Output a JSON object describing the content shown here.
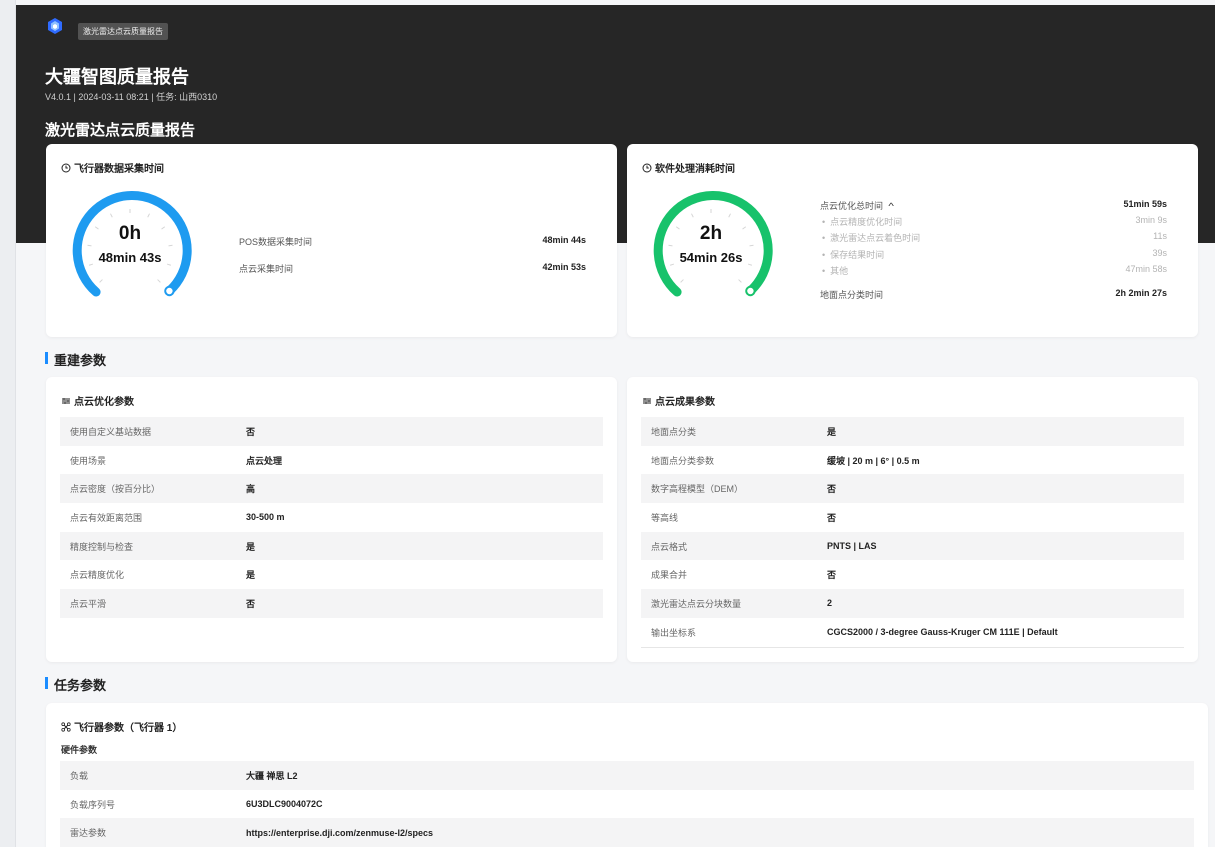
{
  "header": {
    "tag": "激光雷达点云质量报告",
    "app_title": "大疆智图质量报告",
    "meta": "V4.0.1 | 2024-03-11 08:21 | 任务: 山西0310",
    "report_title": "激光雷达点云质量报告"
  },
  "flight_time": {
    "title": "飞行器数据采集时间",
    "gauge_hours": "0h",
    "gauge_detail": "48min 43s",
    "rows": [
      {
        "label": "POS数据采集时间",
        "value": "48min 44s"
      },
      {
        "label": "点云采集时间",
        "value": "42min 53s"
      }
    ]
  },
  "software_time": {
    "title": "软件处理消耗时间",
    "gauge_hours": "2h",
    "gauge_detail": "54min 26s",
    "total": {
      "label": "点云优化总时间",
      "value": "51min 59s",
      "toggle": "^"
    },
    "sub_rows": [
      {
        "label": "点云精度优化时间",
        "value": "3min 9s"
      },
      {
        "label": "激光雷达点云着色时间",
        "value": "11s"
      },
      {
        "label": "保存结果时间",
        "value": "39s"
      },
      {
        "label": "其他",
        "value": "47min 58s"
      }
    ],
    "ground": {
      "label": "地面点分类时间",
      "value": "2h 2min 27s"
    }
  },
  "section_rebuild": "重建参数",
  "optimize_params": {
    "title": "点云优化参数",
    "rows": [
      {
        "k": "使用自定义基站数据",
        "v": "否"
      },
      {
        "k": "使用场景",
        "v": "点云处理"
      },
      {
        "k": "点云密度（按百分比）",
        "v": "高"
      },
      {
        "k": "点云有效距离范围",
        "v": "30-500 m"
      },
      {
        "k": "精度控制与检查",
        "v": "是"
      },
      {
        "k": "点云精度优化",
        "v": "是"
      },
      {
        "k": "点云平滑",
        "v": "否"
      }
    ]
  },
  "result_params": {
    "title": "点云成果参数",
    "rows": [
      {
        "k": "地面点分类",
        "v": "是"
      },
      {
        "k": "地面点分类参数",
        "v": "缓坡 | 20 m | 6° | 0.5 m"
      },
      {
        "k": "数字高程模型（DEM）",
        "v": "否"
      },
      {
        "k": "等高线",
        "v": "否"
      },
      {
        "k": "点云格式",
        "v": "PNTS  |  LAS"
      },
      {
        "k": "成果合并",
        "v": "否"
      },
      {
        "k": "激光雷达点云分块数量",
        "v": "2"
      },
      {
        "k": "输出坐标系",
        "v": "CGCS2000 / 3-degree Gauss-Kruger CM 111E | Default"
      }
    ]
  },
  "section_task": "任务参数",
  "aircraft": {
    "title": "飞行器参数（飞行器 1）",
    "subhead": "硬件参数",
    "rows": [
      {
        "k": "负载",
        "v": "大疆 禅思 L2"
      },
      {
        "k": "负载序列号",
        "v": "6U3DLC9004072C"
      },
      {
        "k": "雷达参数",
        "v": "https://enterprise.dji.com/zenmuse-l2/specs"
      }
    ]
  },
  "colors": {
    "blue_gauge": "#1e9bf0",
    "green_gauge": "#17c26b",
    "accent": "#1a8cff"
  },
  "gauges": {
    "flight_fill": 1.0,
    "software_fill": 1.0
  }
}
